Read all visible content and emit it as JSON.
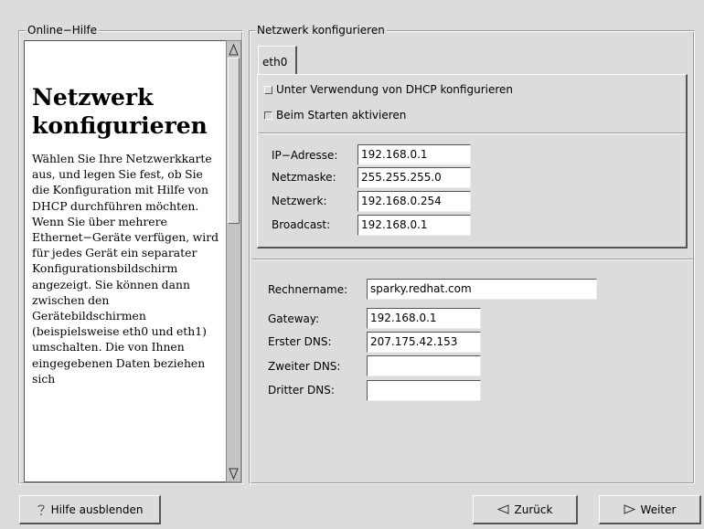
{
  "help": {
    "frame_title": "Online−Hilfe",
    "heading": "Netzwerk konfigurieren",
    "body": "Wählen Sie Ihre Netzwerkkarte aus, und legen Sie fest, ob Sie die Konfiguration mit Hilfe von DHCP durchführen möchten. Wenn Sie über mehrere Ethernet−Geräte verfügen, wird für jedes Gerät ein separater Konfigurationsbildschirm angezeigt. Sie können dann zwischen den Gerätebildschirmen (beispielsweise eth0 und eth1) umschalten. Die von Ihnen eingegebenen Daten beziehen sich"
  },
  "network": {
    "frame_title": "Netzwerk konfigurieren",
    "tab_label": "eth0",
    "dhcp_label": "Unter Verwendung von DHCP konfigurieren",
    "dhcp_checked": false,
    "boot_label": "Beim Starten aktivieren",
    "boot_checked": true,
    "ip_label": "IP−Adresse:",
    "ip_value": "192.168.0.1",
    "netmask_label": "Netzmaske:",
    "netmask_value": "255.255.255.0",
    "network_label": "Netzwerk:",
    "network_value": "192.168.0.254",
    "broadcast_label": "Broadcast:",
    "broadcast_value": "192.168.0.1",
    "hostname_label": "Rechnername:",
    "hostname_value": "sparky.redhat.com",
    "gateway_label": "Gateway:",
    "gateway_value": "192.168.0.1",
    "dns1_label": "Erster DNS:",
    "dns1_value": "207.175.42.153",
    "dns2_label": "Zweiter DNS:",
    "dns2_value": "",
    "dns3_label": "Dritter DNS:",
    "dns3_value": ""
  },
  "buttons": {
    "hide_help": "Hilfe ausblenden",
    "back": "Zurück",
    "next": "Weiter"
  },
  "icons": {
    "hide_help": "question-mark-icon",
    "back": "triangle-left-icon",
    "next": "triangle-right-icon",
    "scroll_up": "scroll-up-arrow-icon",
    "scroll_down": "scroll-down-arrow-icon"
  }
}
